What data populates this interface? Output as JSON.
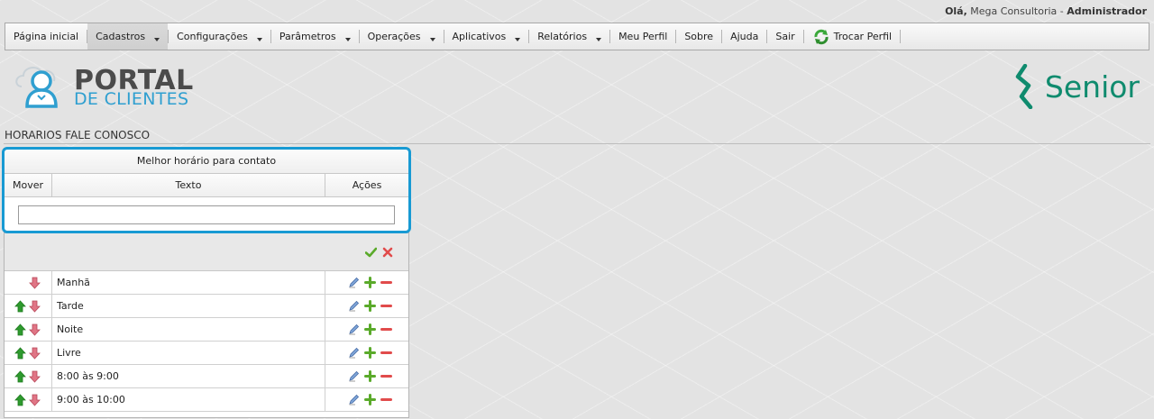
{
  "header": {
    "greeting": "Olá,",
    "company": "Mega Consultoria",
    "separator": "-",
    "role": "Administrador"
  },
  "menu": [
    {
      "label": "Página inicial",
      "dropdown": false,
      "active": false
    },
    {
      "label": "Cadastros",
      "dropdown": true,
      "active": true
    },
    {
      "label": "Configurações",
      "dropdown": true,
      "active": false
    },
    {
      "label": "Parâmetros",
      "dropdown": true,
      "active": false
    },
    {
      "label": "Operações",
      "dropdown": true,
      "active": false
    },
    {
      "label": "Aplicativos",
      "dropdown": true,
      "active": false
    },
    {
      "label": "Relatórios",
      "dropdown": true,
      "active": false
    },
    {
      "label": "Meu Perfil",
      "dropdown": false,
      "active": false
    },
    {
      "label": "Sobre",
      "dropdown": false,
      "active": false
    },
    {
      "label": "Ajuda",
      "dropdown": false,
      "active": false
    },
    {
      "label": "Sair",
      "dropdown": false,
      "active": false
    },
    {
      "label": "Trocar Perfil",
      "dropdown": false,
      "active": false,
      "icon": "swap-icon"
    }
  ],
  "logo": {
    "portal_line1": "PORTAL",
    "portal_line2": "DE CLIENTES",
    "brand": "Senior"
  },
  "page": {
    "title": "HORARIOS FALE CONOSCO"
  },
  "grid": {
    "caption": "Melhor horário para contato",
    "columns": {
      "mover": "Mover",
      "texto": "Texto",
      "acoes": "Ações"
    },
    "filter": {
      "value": "",
      "placeholder": ""
    },
    "rows": [
      {
        "texto": "Manhã",
        "up": false,
        "down": true
      },
      {
        "texto": "Tarde",
        "up": true,
        "down": true
      },
      {
        "texto": "Noite",
        "up": true,
        "down": true
      },
      {
        "texto": "Livre",
        "up": true,
        "down": true
      },
      {
        "texto": "8:00 às 9:00",
        "up": true,
        "down": true
      },
      {
        "texto": "9:00 às 10:00",
        "up": true,
        "down": true
      }
    ]
  },
  "colors": {
    "accent_blue": "#189ad3",
    "senior_green": "#0f8b6e",
    "arrow_up": "#2e9a2e",
    "arrow_down": "#cf5b6b",
    "delete_red": "#e14b4b",
    "add_green": "#5aaa2a"
  }
}
